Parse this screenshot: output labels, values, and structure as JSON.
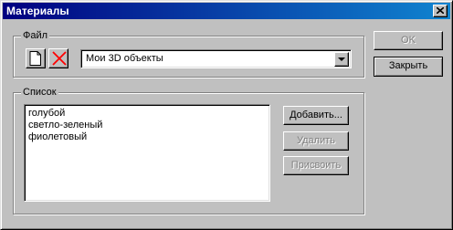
{
  "window": {
    "title": "Материалы"
  },
  "file_group": {
    "label": "Файл",
    "library_value": "Мои 3D объекты"
  },
  "list_group": {
    "label": "Список",
    "items": [
      "голубой",
      "светло-зеленый",
      "фиолетовый"
    ]
  },
  "buttons": {
    "ok": "OK",
    "close": "Закрыть",
    "add": "Добавить...",
    "delete": "Удалить",
    "assign": "Присвоить"
  },
  "colors": {
    "titlebar_start": "#000080",
    "titlebar_end": "#1084d0",
    "delete_x": "#ff0000"
  }
}
